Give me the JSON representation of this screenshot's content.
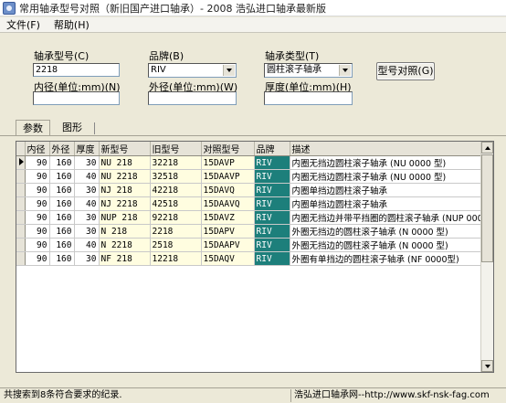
{
  "window": {
    "title": "常用轴承型号对照（新旧国产进口轴承）- 2008 浩弘进口轴承最新版"
  },
  "menu": {
    "items": [
      {
        "label": "文件(F)"
      },
      {
        "label": "帮助(H)"
      }
    ]
  },
  "form": {
    "bearing_model_label": "轴承型号(C)",
    "bearing_model_value": "2218",
    "brand_label": "品牌(B)",
    "brand_value": "RIV",
    "bearing_type_label": "轴承类型(T)",
    "bearing_type_value": "圆柱滚子轴承",
    "compare_button": "型号对照(G)",
    "inner_diameter_label": "内径(单位:mm)(N)",
    "inner_diameter_value": "",
    "outer_diameter_label": "外径(单位:mm)(W)",
    "outer_diameter_value": "",
    "thickness_label": "厚度(单位:mm)(H)",
    "thickness_value": ""
  },
  "tabs": [
    {
      "label": "参数",
      "active": true
    },
    {
      "label": "图形",
      "active": false
    }
  ],
  "table": {
    "columns": [
      "内径",
      "外径",
      "厚度",
      "新型号",
      "旧型号",
      "对照型号",
      "品牌",
      "描述"
    ],
    "rows": [
      {
        "inner": "90",
        "outer": "160",
        "thickness": "30",
        "new_model": "NU 218",
        "old_model": "32218",
        "compare_model": "15DAVP",
        "brand": "RIV",
        "desc": "内圈无挡边圆柱滚子轴承 (NU 0000 型)"
      },
      {
        "inner": "90",
        "outer": "160",
        "thickness": "40",
        "new_model": "NU 2218",
        "old_model": "32518",
        "compare_model": "15DAAVP",
        "brand": "RIV",
        "desc": "内圈无挡边圆柱滚子轴承 (NU 0000 型)"
      },
      {
        "inner": "90",
        "outer": "160",
        "thickness": "30",
        "new_model": "NJ 218",
        "old_model": "42218",
        "compare_model": "15DAVQ",
        "brand": "RIV",
        "desc": "内圈单挡边圆柱滚子轴承"
      },
      {
        "inner": "90",
        "outer": "160",
        "thickness": "40",
        "new_model": "NJ 2218",
        "old_model": "42518",
        "compare_model": "15DAAVQ",
        "brand": "RIV",
        "desc": "内圈单挡边圆柱滚子轴承"
      },
      {
        "inner": "90",
        "outer": "160",
        "thickness": "30",
        "new_model": "NUP 218",
        "old_model": "92218",
        "compare_model": "15DAVZ",
        "brand": "RIV",
        "desc": "内圈无挡边并带平挡圈的圆柱滚子轴承 (NUP 000"
      },
      {
        "inner": "90",
        "outer": "160",
        "thickness": "30",
        "new_model": "N 218",
        "old_model": "2218",
        "compare_model": "15DAPV",
        "brand": "RIV",
        "desc": "外圈无挡边的圆柱滚子轴承 (N 0000 型)"
      },
      {
        "inner": "90",
        "outer": "160",
        "thickness": "40",
        "new_model": "N 2218",
        "old_model": "2518",
        "compare_model": "15DAAPV",
        "brand": "RIV",
        "desc": "外圈无挡边的圆柱滚子轴承 (N 0000 型)"
      },
      {
        "inner": "90",
        "outer": "160",
        "thickness": "30",
        "new_model": "NF 218",
        "old_model": "12218",
        "compare_model": "15DAQV",
        "brand": "RIV",
        "desc": "外圈有单挡边的圆柱滚子轴承 (NF 0000型)"
      }
    ]
  },
  "status": {
    "left": "共搜索到8条符合要求的纪录.",
    "right": "浩弘进口轴承网--http://www.skf-nsk-fag.com"
  },
  "colors": {
    "window_bg": "#ece9d8",
    "highlight_yellow": "#fffde0",
    "brand_teal": "#1d7f7b",
    "grid_header": "#e6e3d8"
  }
}
